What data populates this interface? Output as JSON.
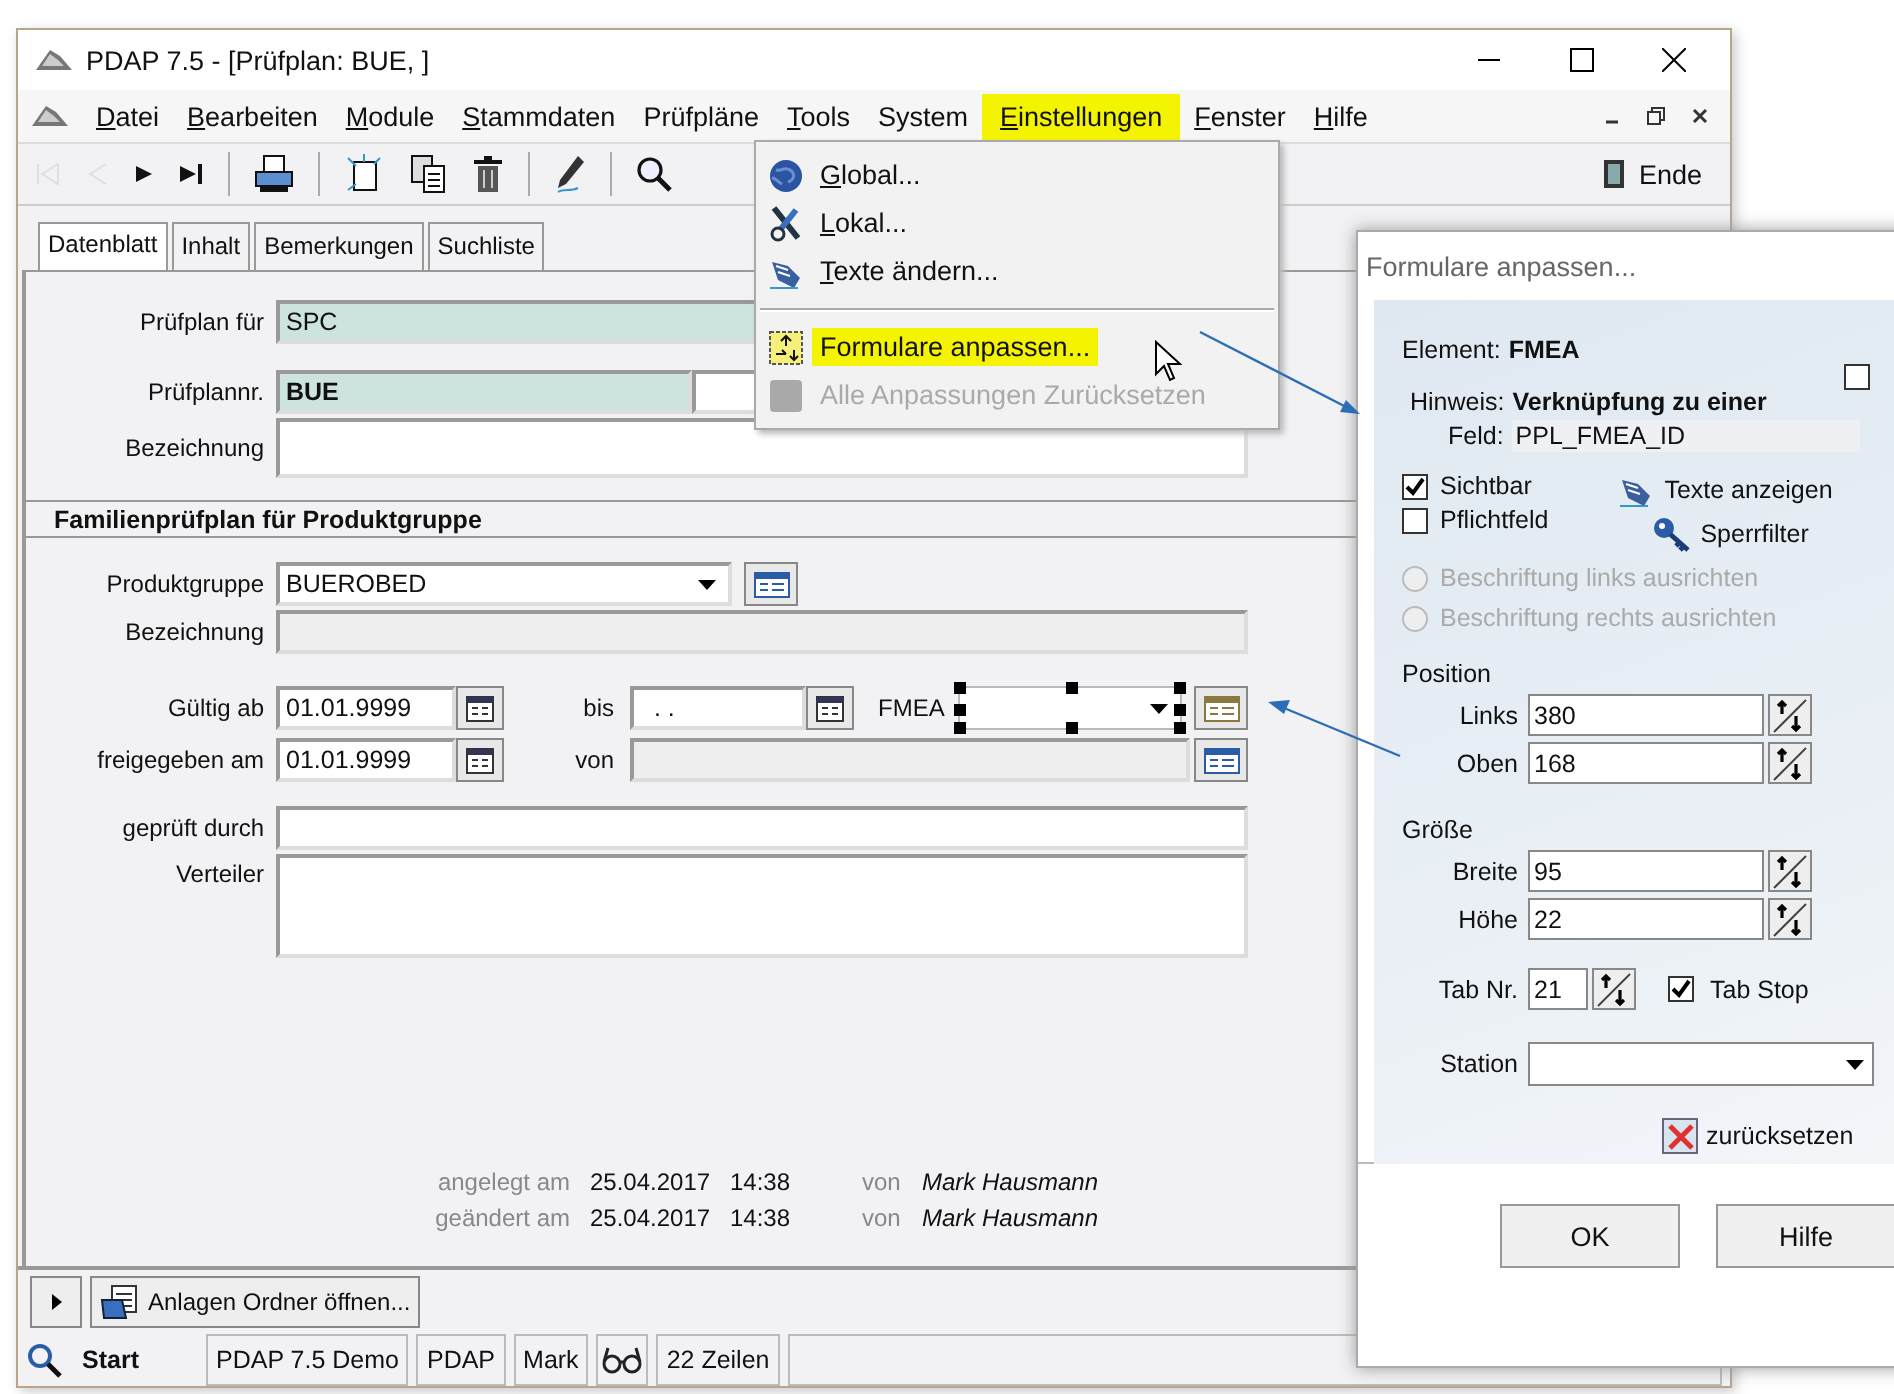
{
  "window": {
    "title": "PDAP 7.5 - [Prüfplan: BUE, ]"
  },
  "menu": [
    {
      "label": "Datei",
      "mnemonic": true,
      "selected": false
    },
    {
      "label": "Bearbeiten",
      "mnemonic": true,
      "selected": false
    },
    {
      "label": "Module",
      "mnemonic": true,
      "selected": false
    },
    {
      "label": "Stammdaten",
      "mnemonic": true,
      "selected": false
    },
    {
      "label": "Prüfpläne",
      "mnemonic": false,
      "selected": false
    },
    {
      "label": "Tools",
      "mnemonic": true,
      "selected": false
    },
    {
      "label": "System",
      "mnemonic": false,
      "selected": false
    },
    {
      "label": "Einstellungen",
      "mnemonic": true,
      "selected": true
    },
    {
      "label": "Fenster",
      "mnemonic": true,
      "selected": false
    },
    {
      "label": "Hilfe",
      "mnemonic": true,
      "selected": false
    }
  ],
  "toolbar": {
    "buttons": [
      {
        "kind": "first",
        "disabled": true
      },
      {
        "kind": "prev",
        "disabled": true
      },
      {
        "kind": "next",
        "disabled": false
      },
      {
        "kind": "last",
        "disabled": false
      },
      {
        "kind": "sep"
      },
      {
        "kind": "print",
        "disabled": false
      },
      {
        "kind": "sep"
      },
      {
        "kind": "new",
        "disabled": false
      },
      {
        "kind": "copy",
        "disabled": false
      },
      {
        "kind": "delete",
        "disabled": false
      },
      {
        "kind": "sep"
      },
      {
        "kind": "edit",
        "disabled": false
      },
      {
        "kind": "sep"
      },
      {
        "kind": "search",
        "disabled": false
      }
    ],
    "end_label": "Ende"
  },
  "tabs": [
    {
      "label": "Datenblatt",
      "selected": true
    },
    {
      "label": "Inhalt",
      "selected": false
    },
    {
      "label": "Bemerkungen",
      "selected": false
    },
    {
      "label": "Suchliste",
      "selected": false
    }
  ],
  "test_plan": {
    "for_label": "Prüfplan für",
    "for_value": "SPC",
    "number_label": "Prüfplannr.",
    "number_value": "BUE",
    "description_label": "Bezeichnung"
  },
  "family": {
    "title": "Familienprüfplan für Produktgruppe",
    "product_group_label": "Produktgruppe",
    "product_group_value": "BUEROBED",
    "description_label": "Bezeichnung",
    "valid_from_label": "Gültig ab",
    "valid_from_value": "01.01.9999",
    "to_label": "bis",
    "to_value": ". .",
    "fmea_label": "FMEA",
    "released_label": "freigegeben am",
    "released_value": "01.01.9999",
    "by_label": "von",
    "checked_by_label": "geprüft durch",
    "distribution_label": "Verteiler"
  },
  "audit": [
    {
      "label": "angelegt am",
      "date": "25.04.2017",
      "time": "14:38",
      "by_label": "von",
      "user": "Mark Hausmann"
    },
    {
      "label": "geändert am",
      "date": "25.04.2017",
      "time": "14:38",
      "by_label": "von",
      "user": "Mark Hausmann"
    }
  ],
  "bottom_bar": {
    "attachments_button": "Anlagen Ordner öffnen..."
  },
  "status_bar": {
    "start": "Start",
    "cells": [
      {
        "kind": "text",
        "text": "PDAP 7.5 Demo"
      },
      {
        "kind": "text",
        "text": "PDAP"
      },
      {
        "kind": "text",
        "text": "Mark"
      },
      {
        "kind": "glasses"
      },
      {
        "kind": "text",
        "text": "22 Zeilen"
      }
    ]
  },
  "dropdown_menu": [
    {
      "kind": "globe",
      "label": "Global...",
      "mnemonic": true,
      "selected": false,
      "disabled": false
    },
    {
      "kind": "tools",
      "label": "Lokal...",
      "mnemonic": true,
      "selected": false,
      "disabled": false
    },
    {
      "kind": "hand",
      "label": "Texte ändern...",
      "mnemonic": true,
      "selected": false,
      "disabled": false
    },
    {
      "kind": "separator"
    },
    {
      "kind": "form",
      "label": "Formulare anpassen...",
      "mnemonic": false,
      "selected": true,
      "disabled": false
    },
    {
      "kind": "blank",
      "label": "Alle Anpassungen Zurücksetzen",
      "mnemonic": false,
      "selected": false,
      "disabled": true
    }
  ],
  "dialog": {
    "title": "Formulare anpassen...",
    "element_label": "Element:",
    "element_value": "FMEA",
    "flag_checked": false,
    "hint_label": "Hinweis:",
    "hint_value": "Verknüpfung zu einer",
    "field_label": "Feld:",
    "field_value": "PPL_FMEA_ID",
    "checkboxes": [
      {
        "label": "Sichtbar",
        "checked": true
      },
      {
        "label": "Pflichtfeld",
        "checked": false
      }
    ],
    "show_texts_button": "Texte anzeigen",
    "lock_filter_button": "Sperrfilter",
    "radios": [
      {
        "label": "Beschriftung links ausrichten",
        "selected": false,
        "disabled": true
      },
      {
        "label": "Beschriftung rechts ausrichten",
        "selected": false,
        "disabled": true
      }
    ],
    "position_title": "Position",
    "position": [
      {
        "label": "Links",
        "value": "380"
      },
      {
        "label": "Oben",
        "value": "168"
      }
    ],
    "size_title": "Größe",
    "size": [
      {
        "label": "Breite",
        "value": "95"
      },
      {
        "label": "Höhe",
        "value": "22"
      }
    ],
    "tab_label": "Tab Nr.",
    "tab_value": "21",
    "tab_stop_label": "Tab Stop",
    "tab_stop_checked": true,
    "station_label": "Station",
    "reset_button": "zurücksetzen",
    "buttons": [
      "OK",
      "Hilfe"
    ]
  }
}
